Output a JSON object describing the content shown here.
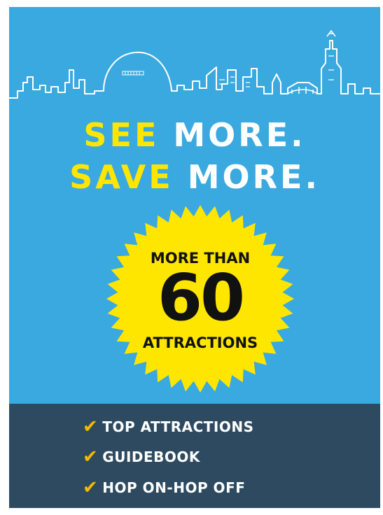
{
  "headline": {
    "line1_highlight": "SEE",
    "line1_rest": "MORE.",
    "line2_highlight": "SAVE",
    "line2_rest": "MORE."
  },
  "badge": {
    "top_text": "MORE THAN",
    "number": "60",
    "bottom_text": "ATTRACTIONS"
  },
  "features": [
    {
      "check_icon": "✔",
      "label": "TOP ATTRACTIONS"
    },
    {
      "check_icon": "✔",
      "label": "GUIDEBOOK"
    },
    {
      "check_icon": "✔",
      "label": "HOP ON-HOP OFF"
    }
  ],
  "colors": {
    "background": "#3aa9e0",
    "accent_yellow": "#ffe600",
    "footer": "#2d4a60",
    "check": "#f6b800"
  }
}
